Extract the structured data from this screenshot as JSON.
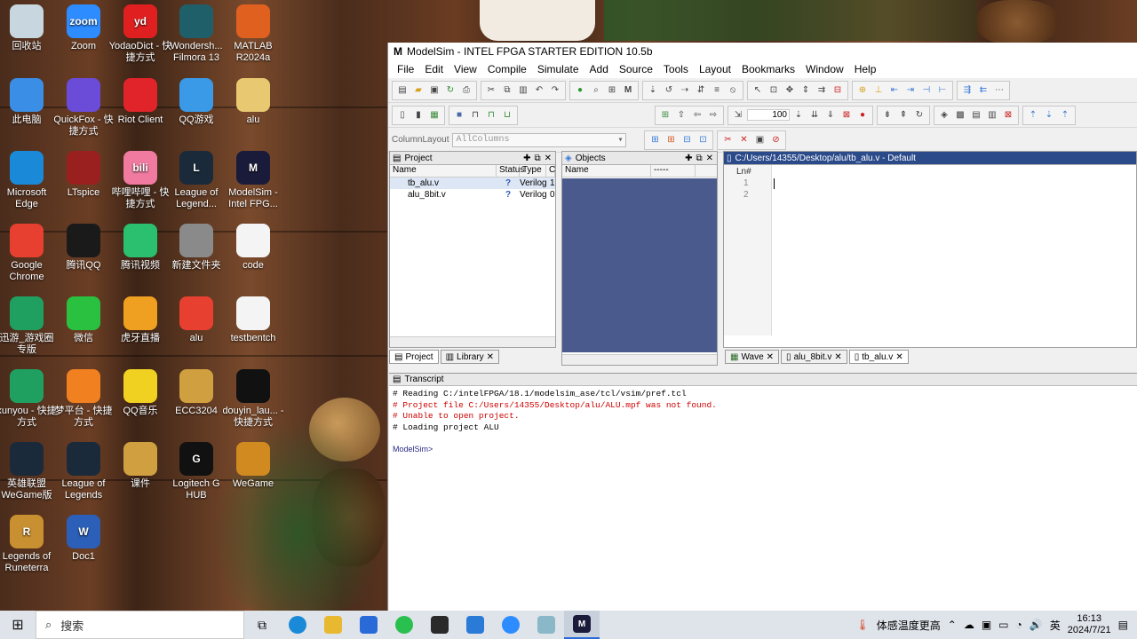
{
  "desktop": {
    "icons": [
      {
        "label": "回收站",
        "icon": "recycle-bin-icon",
        "color": "#c8d6e0"
      },
      {
        "label": "Zoom",
        "icon": "zoom-icon",
        "color": "#2d8cff",
        "glyph": "zoom"
      },
      {
        "label": "YodaoDict - 快捷方式",
        "icon": "yodao-icon",
        "color": "#e02020",
        "glyph": "yd"
      },
      {
        "label": "Wondersh... Filmora 13",
        "icon": "filmora-icon",
        "color": "#1f5f6a"
      },
      {
        "label": "MATLAB R2024a",
        "icon": "matlab-icon",
        "color": "#e06020"
      },
      {
        "label": "此电脑",
        "icon": "this-pc-icon",
        "color": "#3a8ee6"
      },
      {
        "label": "QuickFox - 快捷方式",
        "icon": "quickfox-icon",
        "color": "#6a4cd8"
      },
      {
        "label": "Riot Client",
        "icon": "riot-icon",
        "color": "#e0242a"
      },
      {
        "label": "QQ游戏",
        "icon": "qq-game-icon",
        "color": "#3a9ae8"
      },
      {
        "label": "alu",
        "icon": "folder-icon",
        "color": "#e8c870"
      },
      {
        "label": "Microsoft Edge",
        "icon": "edge-icon",
        "color": "#1a8ad8"
      },
      {
        "label": "LTspice",
        "icon": "ltspice-icon",
        "color": "#9a2020"
      },
      {
        "label": "哔哩哔哩 - 快捷方式",
        "icon": "bilibili-icon",
        "color": "#f07aa0",
        "glyph": "bili"
      },
      {
        "label": "League of Legend...",
        "icon": "league-icon",
        "color": "#1a2a3a",
        "glyph": "L"
      },
      {
        "label": "ModelSim - Intel FPG...",
        "icon": "modelsim-icon",
        "color": "#1a1a3a",
        "glyph": "M"
      },
      {
        "label": "Google Chrome",
        "icon": "chrome-icon",
        "color": "#e84030"
      },
      {
        "label": "腾讯QQ",
        "icon": "qq-icon",
        "color": "#1a1a1a"
      },
      {
        "label": "腾讯视频",
        "icon": "tencent-video-icon",
        "color": "#2ac070"
      },
      {
        "label": "新建文件夹",
        "icon": "folder-icon",
        "color": "#8a8a8a"
      },
      {
        "label": "code",
        "icon": "file-icon",
        "color": "#f4f4f4"
      },
      {
        "label": "迅游_游戏圈专版",
        "icon": "xunyou-icon",
        "color": "#20a060"
      },
      {
        "label": "微信",
        "icon": "wechat-icon",
        "color": "#2ac040"
      },
      {
        "label": "虎牙直播",
        "icon": "huya-icon",
        "color": "#f0a020"
      },
      {
        "label": "alu",
        "icon": "chrome-icon",
        "color": "#e84030"
      },
      {
        "label": "testbentch",
        "icon": "file-icon",
        "color": "#f4f4f4"
      },
      {
        "label": "xunyou - 快捷方式",
        "icon": "xunyou-icon",
        "color": "#20a060"
      },
      {
        "label": "梦平台 - 快捷方式",
        "icon": "dream-platform-icon",
        "color": "#f08020"
      },
      {
        "label": "QQ音乐",
        "icon": "qq-music-icon",
        "color": "#f0d020"
      },
      {
        "label": "ECC3204",
        "icon": "archive-icon",
        "color": "#d0a040"
      },
      {
        "label": "douyin_lau... - 快捷方式",
        "icon": "douyin-icon",
        "color": "#111111"
      },
      {
        "label": "英雄联盟WeGame版",
        "icon": "league-wegame-icon",
        "color": "#1a2a3a"
      },
      {
        "label": "League of Legends",
        "icon": "league-icon",
        "color": "#1a2a3a"
      },
      {
        "label": "课件",
        "icon": "archive-icon",
        "color": "#d0a040"
      },
      {
        "label": "Logitech G HUB",
        "icon": "logitech-icon",
        "color": "#111111",
        "glyph": "G"
      },
      {
        "label": "WeGame",
        "icon": "wegame-icon",
        "color": "#d08a20"
      },
      {
        "label": "Legends of Runeterra",
        "icon": "runeterra-icon",
        "color": "#c89030",
        "glyph": "R"
      },
      {
        "label": "Doc1",
        "icon": "word-icon",
        "color": "#2b5fb8",
        "glyph": "W"
      }
    ]
  },
  "modelsim": {
    "title": "ModelSim - INTEL FPGA STARTER EDITION 10.5b",
    "menu": [
      "File",
      "Edit",
      "View",
      "Compile",
      "Simulate",
      "Add",
      "Source",
      "Tools",
      "Layout",
      "Bookmarks",
      "Window",
      "Help"
    ],
    "column_layout_label": "ColumnLayout",
    "column_layout_value": "AllColumns",
    "zoom_value": "100",
    "project": {
      "title": "Project",
      "columns": [
        "Name",
        "Status",
        "Type",
        "C"
      ],
      "files": [
        {
          "name": "tb_alu.v",
          "status": "?",
          "type": "Verilog",
          "order": "1"
        },
        {
          "name": "alu_8bit.v",
          "status": "?",
          "type": "Verilog",
          "order": "0"
        }
      ],
      "tabs": [
        "Project",
        "Library"
      ]
    },
    "objects": {
      "title": "Objects",
      "columns": [
        "Name",
        "-----"
      ]
    },
    "editor": {
      "path": "C:/Users/14355/Desktop/alu/tb_alu.v - Default",
      "ln_header": "Ln#",
      "lines": [
        "1",
        "2"
      ],
      "tabs": [
        "Wave",
        "alu_8bit.v",
        "tb_alu.v"
      ]
    },
    "transcript": {
      "title": "Transcript",
      "lines": [
        {
          "text": "# Reading C:/intelFPGA/18.1/modelsim_ase/tcl/vsim/pref.tcl",
          "error": false
        },
        {
          "text": "# Project file C:/Users/14355/Desktop/alu/ALU.mpf was not found.",
          "error": true
        },
        {
          "text": "# Unable to open project.",
          "error": true
        },
        {
          "text": "# Loading project ALU",
          "error": false
        }
      ],
      "prompt": "ModelSim>"
    }
  },
  "taskbar": {
    "search_placeholder": "搜索",
    "tray_text": "体感温度更高",
    "ime": "英",
    "time": "16:13",
    "date": "2024/7/21"
  }
}
